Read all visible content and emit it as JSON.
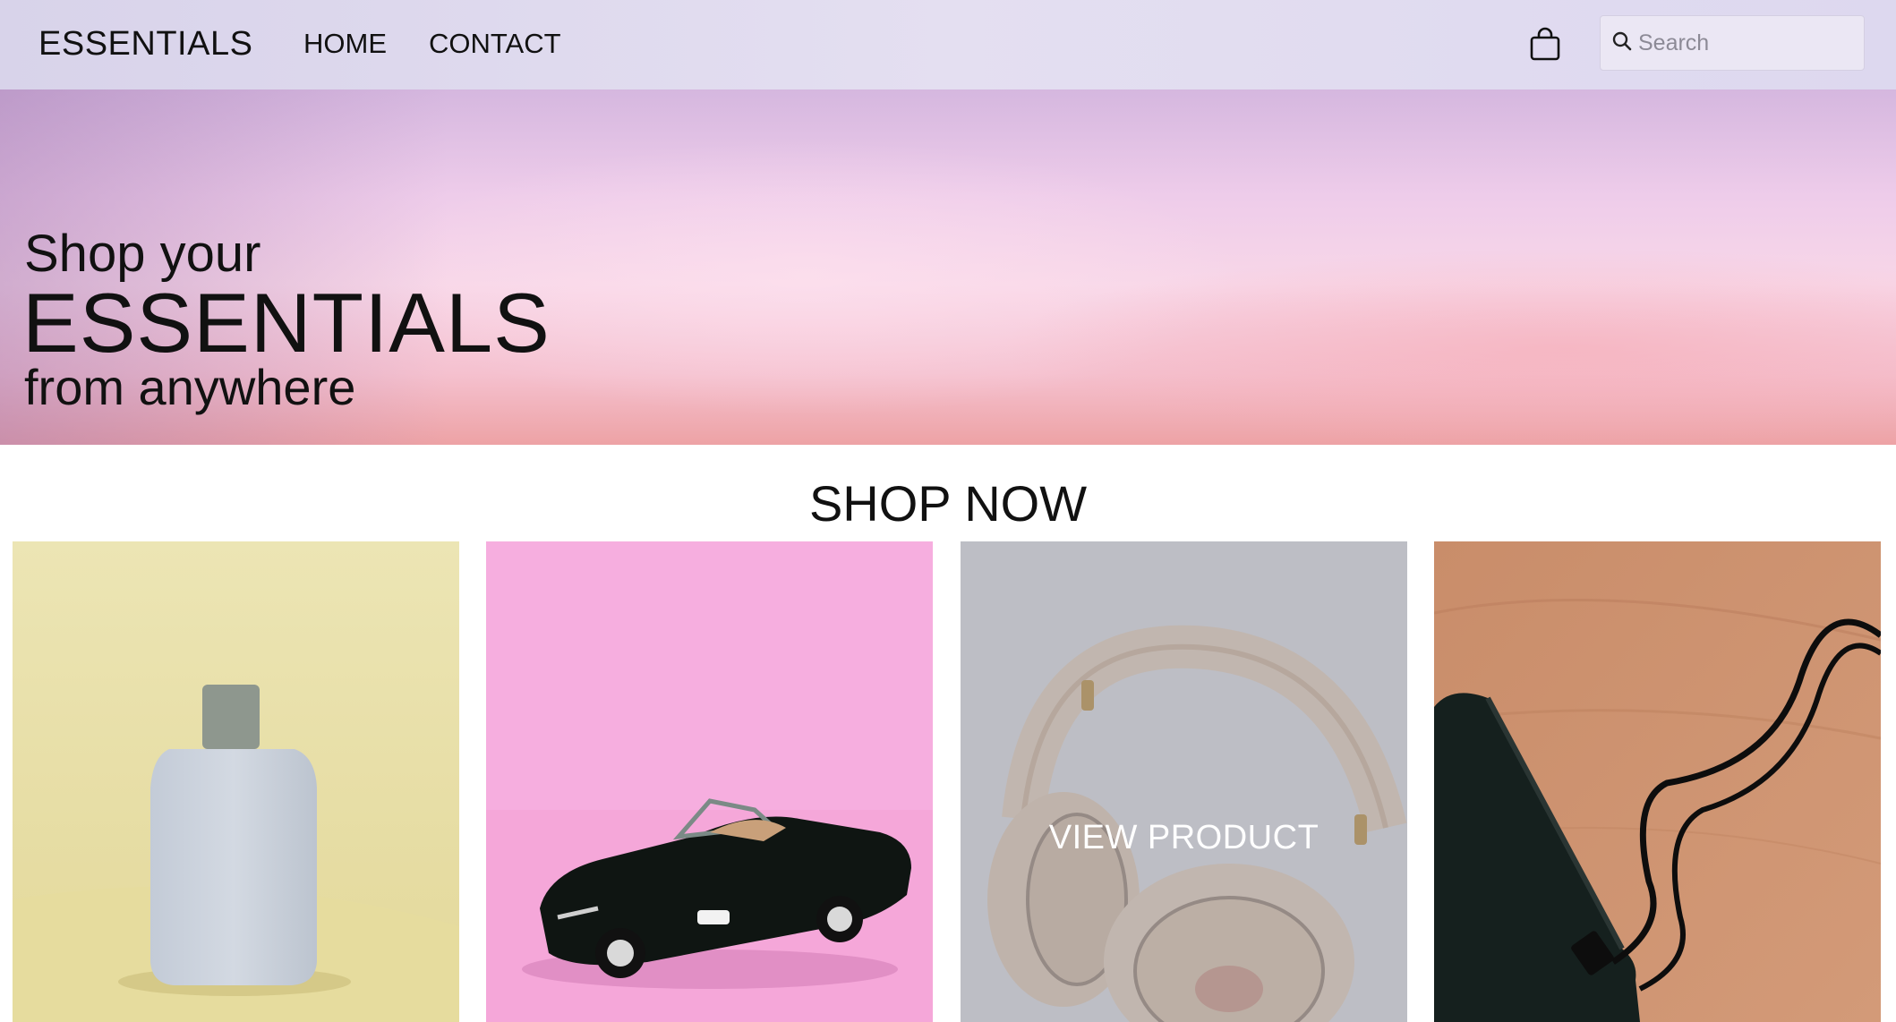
{
  "nav": {
    "brand": "ESSENTIALS",
    "links": [
      "HOME",
      "CONTACT"
    ],
    "cart_icon": "shopping-bag-icon",
    "search": {
      "placeholder": "Search",
      "value": "",
      "icon": "search-icon"
    }
  },
  "hero": {
    "line1": "Shop your",
    "line2": "ESSENTIALS",
    "line3": "from anywhere"
  },
  "shop": {
    "title": "SHOP NOW",
    "hover_label": "VIEW PRODUCT",
    "products": [
      {
        "image": "perfume-bottle",
        "bg": "#eae2ac"
      },
      {
        "image": "toy-convertible-car",
        "bg": "#f5ade0"
      },
      {
        "image": "headphones",
        "bg": "#e0e0e4",
        "hovered": true
      },
      {
        "image": "power-bank-with-cable",
        "bg": "#c98f6d"
      }
    ]
  },
  "colors": {
    "nav_bg": "#e0dbef",
    "hero_top": "#d5b7df",
    "hero_bottom": "#eda2a5",
    "text": "#111111"
  }
}
